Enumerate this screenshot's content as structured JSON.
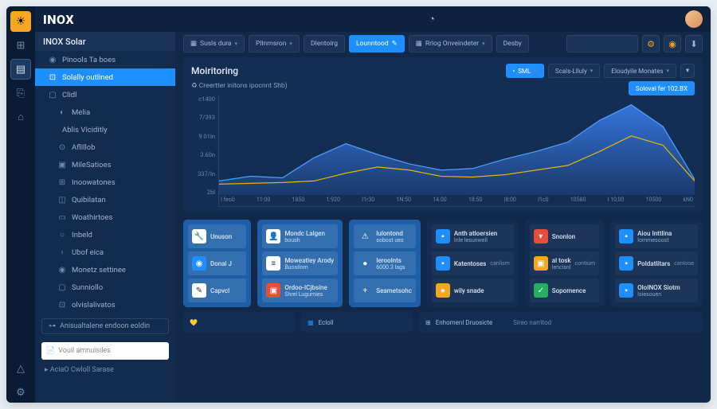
{
  "brand": "INOX",
  "rail": {
    "items": [
      "⊞",
      "▤",
      "⎘",
      "⌂",
      "△",
      "⚙"
    ]
  },
  "sidebar": {
    "header": "INOX Solar",
    "items": [
      {
        "icon": "◉",
        "label": "Pinools Ta boes"
      },
      {
        "icon": "⊡",
        "label": "Solally outlined",
        "active": true
      },
      {
        "icon": "▢",
        "label": "Clidl"
      },
      {
        "icon": "◐",
        "label": "Melia",
        "lvl": 2
      },
      {
        "icon": "",
        "label": "Ablis   Viciditly",
        "lvl": 1
      },
      {
        "icon": "⊙",
        "label": "AflIllob",
        "lvl": 2
      },
      {
        "icon": "▣",
        "label": "MileSatioes",
        "lvl": 2
      },
      {
        "icon": "⊞",
        "label": "Inoowatones",
        "lvl": 2
      },
      {
        "icon": "◫",
        "label": "Quibilatan",
        "lvl": 2
      },
      {
        "icon": "▭",
        "label": "Woathirtoes",
        "lvl": 2
      },
      {
        "icon": "○",
        "label": "Inbeld",
        "lvl": 2
      },
      {
        "icon": "›",
        "label": "Ubof eica",
        "lvl": 2
      },
      {
        "icon": "◉",
        "label": "Monetz settinee",
        "lvl": 2
      },
      {
        "icon": "▢",
        "label": "Sunniollo",
        "lvl": 2
      },
      {
        "icon": "⊡",
        "label": "olvislalivatos",
        "lvl": 2
      }
    ],
    "lowbox": "Anisualtalene endoon eoldin",
    "search_placeholder": "Vouil amnuisiles",
    "footer": "AciaO Cwloll Sarase"
  },
  "toolbar": {
    "btn1": "Susls dura",
    "btn2": "Pllnmsron",
    "btn3": "Dlentoirg",
    "btn4": "Lounntood",
    "btn5": "Rrlog Onveindeter",
    "btn6": "Desby",
    "gear": "⚙",
    "download": "⬇"
  },
  "chart": {
    "title": "Moiritoring",
    "subtitle": "Creertter initons ipocnnt Shb)",
    "ctl1": "SML",
    "ctl2": "Scals-Llluly",
    "ctl3": "Eloudyile Monates",
    "action": "Soloval fer 102.BX"
  },
  "chart_data": {
    "type": "area",
    "title": "Moiritoring",
    "ylabel": "",
    "ylim": [
      0,
      6400
    ],
    "ylabels": [
      "c1400",
      "7/393",
      "9 01In",
      "3.60n",
      "337/In",
      "2bl"
    ],
    "categories": [
      "I feo0",
      "11:00",
      "1850",
      "1:920",
      "I1r30",
      "1N:50",
      "14.00",
      "18:50",
      "|8:00",
      "I1c0",
      "10580",
      "I 10,00",
      "10500",
      "kN0"
    ],
    "series": [
      {
        "name": "primary",
        "color": "#3b82f6",
        "values": [
          900,
          1200,
          1100,
          2400,
          3300,
          2600,
          2000,
          1600,
          1700,
          2300,
          2800,
          3400,
          4800,
          5800,
          4400,
          1000
        ]
      },
      {
        "name": "secondary",
        "color": "#eab308",
        "values": [
          700,
          750,
          800,
          900,
          1400,
          1800,
          1600,
          1200,
          1150,
          1300,
          1600,
          1900,
          2800,
          3800,
          3200,
          900
        ]
      }
    ]
  },
  "cards": {
    "col1": [
      {
        "ico": "🔧",
        "bg": "#fff",
        "t": "Unuson",
        "s": "",
        "r": ""
      },
      {
        "ico": "◉",
        "bg": "#1f8fff",
        "t": "Donal J",
        "s": "",
        "r": ""
      },
      {
        "ico": "✎",
        "bg": "#fff",
        "t": "Capvcl",
        "s": "",
        "r": ""
      }
    ],
    "col2": [
      {
        "ico": "👤",
        "bg": "#fff",
        "t": "Mondc Lalgen",
        "s": "boush",
        "r": ""
      },
      {
        "ico": "≡",
        "bg": "#fff",
        "t": "Moweatley Arody",
        "s": "Buosilom",
        "r": ""
      },
      {
        "ico": "▣",
        "bg": "#e74c3c",
        "t": "Ordoo-ICjbsine",
        "s": "Shrel Lugumies",
        "r": ""
      }
    ],
    "col3": [
      {
        "ico": "⚠",
        "bg": "",
        "t": "lulontond",
        "s": "sobost ues",
        "r": ""
      },
      {
        "ico": "●",
        "bg": "",
        "t": "Ieroolnts",
        "s": "6000.3 lags",
        "r": ""
      },
      {
        "ico": "+",
        "bg": "",
        "t": "Seametsohc",
        "s": "",
        "r": ""
      }
    ],
    "col4": [
      {
        "ico": "▪",
        "bg": "#1f8fff",
        "t": "Anth atloersien",
        "s": "Inle lesunwell",
        "r": ""
      },
      {
        "ico": "▪",
        "bg": "#1f8fff",
        "t": "Katentoses",
        "s": "",
        "r": "canlism"
      },
      {
        "ico": "●",
        "bg": "#f5a623",
        "t": "wily snade",
        "s": "",
        "r": ""
      }
    ],
    "col5": [
      {
        "ico": "▾",
        "bg": "#e74c3c",
        "t": "Snonlon",
        "s": "",
        "r": ""
      },
      {
        "ico": "▣",
        "bg": "#f5a623",
        "t": "al tosk",
        "s": "lencisnl",
        "r": "contium"
      },
      {
        "ico": "✓",
        "bg": "#27ae60",
        "t": "Sopomence",
        "s": "",
        "r": ""
      }
    ],
    "col6": [
      {
        "ico": "▪",
        "bg": "#1f8fff",
        "t": "Aiou Inttlina",
        "s": "Iommesoost",
        "r": ""
      },
      {
        "ico": "▪",
        "bg": "#1f8fff",
        "t": "Poldatlitars",
        "s": "",
        "r": "canlooe"
      },
      {
        "ico": "▪",
        "bg": "#1f8fff",
        "t": "OloINOX Siotm",
        "s": "Isiesouen",
        "r": ""
      }
    ]
  },
  "footer": {
    "f1": "💛",
    "f2_ico": "▦",
    "f2": "Ecloll",
    "f3_ico": "⊞",
    "f3a": "Enhomenl Druosicte",
    "f3b": "Sireo narritod"
  }
}
